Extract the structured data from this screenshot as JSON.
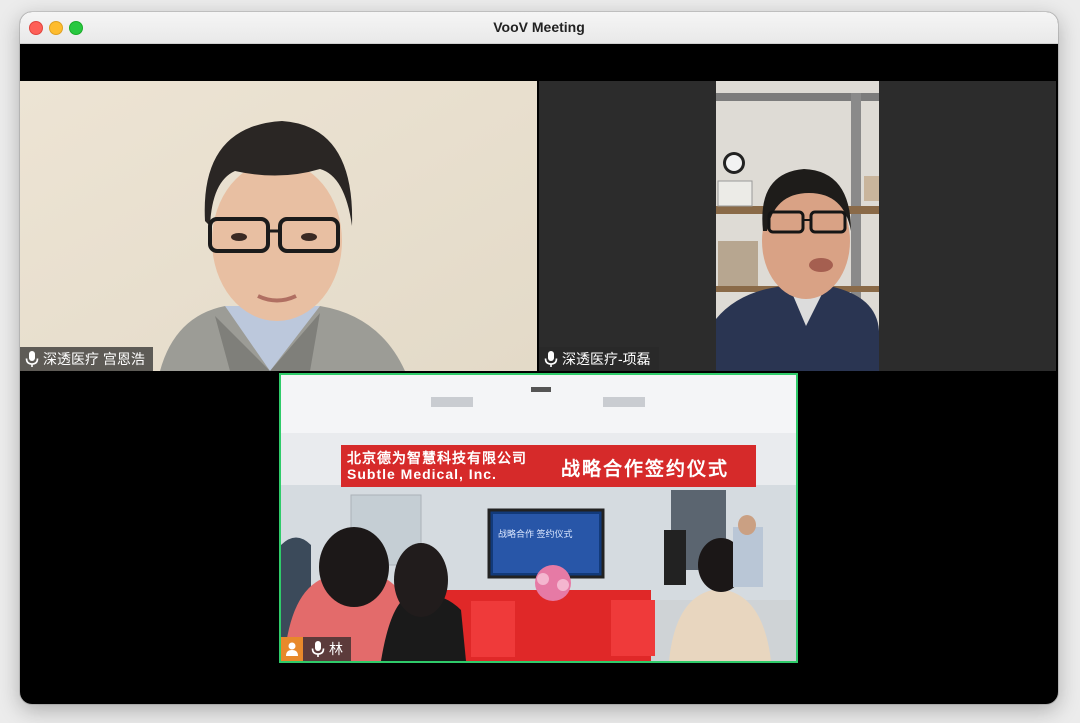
{
  "window": {
    "title": "VooV Meeting"
  },
  "participants": [
    {
      "name": "深透医疗 宫恩浩"
    },
    {
      "name": "深透医疗-项磊"
    },
    {
      "name": "林"
    }
  ],
  "banner": {
    "company_cn": "北京德为智慧科技有限公司",
    "company_en": "Subtle Medical, Inc.",
    "event": "战略合作签约仪式"
  },
  "screen": {
    "text": "战略合作 签约仪式"
  },
  "colors": {
    "speaking_border": "#2fcb6a",
    "banner_red": "#d62a2a"
  }
}
